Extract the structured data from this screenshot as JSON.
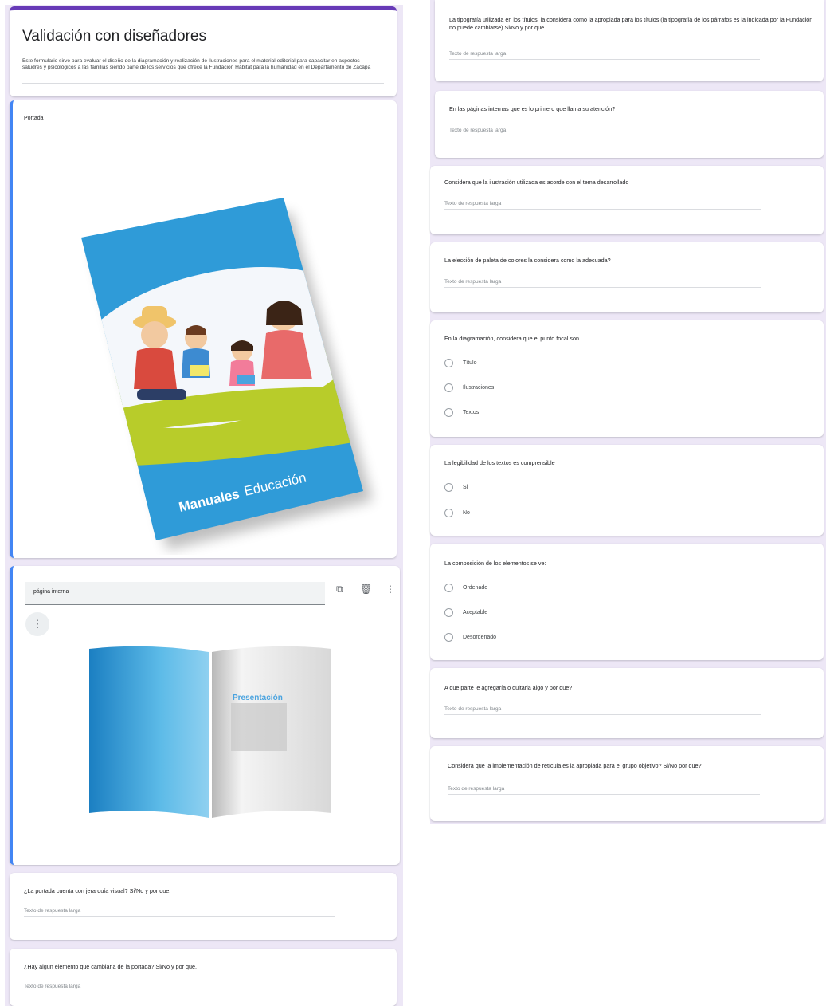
{
  "form": {
    "title": "Validación con diseñadores",
    "description": "Este formulario sirve para evaluar el diseño de la diagramación y realización de ilustraciones para el material editorial para capacitar en aspectos saludres y psicológicos a las familias siendo parte de los servicios que ofrece la Fundación Hábitat para la humanidad en el Departamento de Zacapa"
  },
  "cover_section": {
    "label": "Portada",
    "brochure_title_1": "Manuales",
    "brochure_title_2": "Educación"
  },
  "interior_section": {
    "title_value": "página interna",
    "book_heading": "Presentación"
  },
  "icons": {
    "copy": "copy-icon",
    "delete": "trash-icon",
    "menu": "more-vert-icon"
  },
  "left_questions": [
    {
      "question": "¿La portada cuenta con jerarquía visual? Si/No y por que.",
      "answer_placeholder": "Texto de respuesta larga"
    },
    {
      "question": "¿Hay algun elemento que cambiaria de la portada? Si/No y por que.",
      "answer_placeholder": "Texto de respuesta larga"
    }
  ],
  "right_questions": {
    "q1": {
      "question": "La tipografía utilizada en los títulos, la considera como la apropiada para los títulos (la tipografía de los párrafos es la indicada por la Fundación no puede cambiarse) Si/No y por que.",
      "answer_placeholder": "Texto de respuesta larga"
    },
    "q2": {
      "question": "En las páginas internas que es lo primero que llama su atención?",
      "answer_placeholder": "Texto de respuesta larga"
    },
    "q3": {
      "question": "Considera que la ilustración utilizada es acorde con el tema desarrollado",
      "answer_placeholder": "Texto de respuesta larga"
    },
    "q4": {
      "question": "La elección de paleta de colores la considera como la adecuada?",
      "answer_placeholder": "Texto de respuesta larga"
    },
    "q5": {
      "question": "En la diagramación, considera que el punto focal son",
      "options": [
        "Título",
        "Ilustraciones",
        "Textos"
      ]
    },
    "q6": {
      "question": "La legibilidad de los textos es comprensible",
      "options": [
        "Si",
        "No"
      ]
    },
    "q7": {
      "question": "La composición de los elementos se ve:",
      "options": [
        "Ordenado",
        "Aceptable",
        "Desordenado"
      ]
    },
    "q8": {
      "question": "A que parte le agregaría o quitaria algo y por que?",
      "answer_placeholder": "Texto de respuesta larga"
    },
    "q9": {
      "question": "Considera que la implementación de retícula es la apropiada para el grupo objetivo? Si/No por que?",
      "answer_placeholder": "Texto de respuesta larga"
    }
  },
  "colors": {
    "accent": "#673ab7",
    "active_border": "#4285f4",
    "background": "#ede7f6",
    "brochure_blue": "#2f9bd8",
    "brochure_green": "#b8cc2a"
  }
}
